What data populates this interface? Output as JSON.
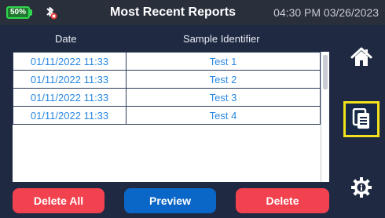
{
  "header": {
    "battery": "50%",
    "title": "Most Recent Reports",
    "datetime": "04:30 PM 03/26/2023",
    "icons": [
      "battery-icon",
      "bluetooth-disconnected-icon"
    ]
  },
  "table": {
    "columns": [
      "Date",
      "Sample Identifier"
    ],
    "rows": [
      {
        "date": "01/11/2022 11:33",
        "sample_id": "Test 1"
      },
      {
        "date": "01/11/2022 11:33",
        "sample_id": "Test 2"
      },
      {
        "date": "01/11/2022 11:33",
        "sample_id": "Test 3"
      },
      {
        "date": "01/11/2022 11:33",
        "sample_id": "Test 4"
      }
    ]
  },
  "buttons": {
    "delete_all": "Delete All",
    "preview": "Preview",
    "delete": "Delete"
  },
  "sidebar": {
    "items": [
      {
        "icon": "home-icon"
      },
      {
        "icon": "reports-icon",
        "active": true
      },
      {
        "icon": "settings-icon"
      }
    ]
  },
  "colors": {
    "background": "#1f2a42",
    "topbar": "#2a2f3c",
    "accent_blue": "#0b67c7",
    "accent_red": "#f2424f",
    "highlight": "#f3e21b",
    "battery_green": "#2fd64e"
  }
}
